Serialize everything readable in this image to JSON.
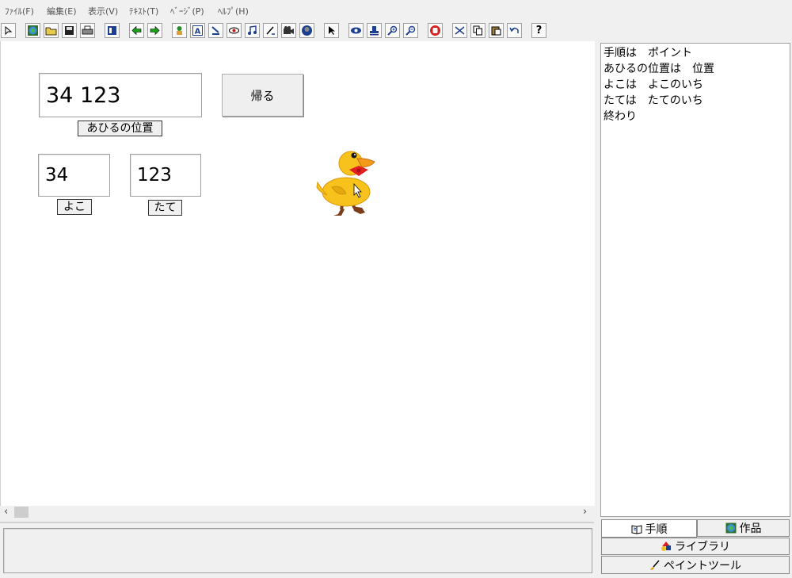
{
  "menu": [
    "ﾌｧｲﾙ(F)",
    "編集(E)",
    "表示(V)",
    "ﾃｷｽﾄ(T)",
    "ﾍﾞｰｼﾞ(P)",
    "ﾍﾙﾌﾟ(H)"
  ],
  "toolbar_icons": [
    "pointer-mode-icon",
    "globe-icon",
    "open-folder-icon",
    "save-icon",
    "print-icon",
    "page-icon",
    "back-arrow-icon",
    "forward-arrow-icon",
    "character-icon",
    "text-tool-icon",
    "paint-tool-icon",
    "eye-tool-icon",
    "music-icon",
    "pen-icon",
    "video-icon",
    "world-icon",
    "select-arrow-icon",
    "view-icon",
    "stamp-icon",
    "zoom-in-icon",
    "zoom-out-icon",
    "stop-hand-icon",
    "cut-icon",
    "copy-icon",
    "paste-icon",
    "undo-icon",
    "help-icon"
  ],
  "canvas": {
    "position_field_value": "34 123",
    "position_label": "あひるの位置",
    "return_button": "帰る",
    "x_field_value": "34",
    "x_label": "よこ",
    "y_field_value": "123",
    "y_label": "たて"
  },
  "script_lines": [
    "手順は　ポイント",
    "あひるの位置は　位置",
    "よこは　よこのいち",
    "たては　たてのいち",
    "終わり"
  ],
  "tabs": {
    "procedure": "手順",
    "work": "作品",
    "library": "ライブラリ",
    "paint": "ペイントツール"
  }
}
